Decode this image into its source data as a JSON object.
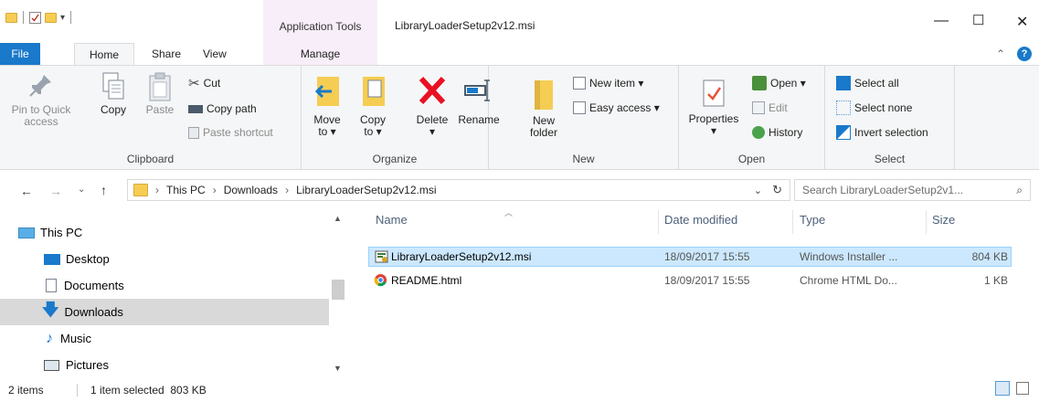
{
  "window": {
    "context_tab": "Application Tools",
    "title": "LibraryLoaderSetup2v12.msi",
    "minimize": "—",
    "maximize": "☐",
    "close": "✕"
  },
  "tabs": {
    "file": "File",
    "home": "Home",
    "share": "Share",
    "view": "View",
    "manage": "Manage"
  },
  "ribbon": {
    "clipboard": {
      "pin": "Pin to Quick\naccess",
      "copy": "Copy",
      "paste": "Paste",
      "cut": "Cut",
      "copy_path": "Copy path",
      "paste_shortcut": "Paste shortcut",
      "label": "Clipboard"
    },
    "organize": {
      "move_to": "Move\nto ▾",
      "copy_to": "Copy\nto ▾",
      "delete": "Delete\n▾",
      "rename": "Rename",
      "label": "Organize"
    },
    "new": {
      "new_folder": "New\nfolder",
      "new_item": "New item ▾",
      "easy_access": "Easy access ▾",
      "label": "New"
    },
    "open": {
      "properties": "Properties\n▾",
      "open": "Open ▾",
      "edit": "Edit",
      "history": "History",
      "label": "Open"
    },
    "select": {
      "select_all": "Select all",
      "select_none": "Select none",
      "invert": "Invert selection",
      "label": "Select"
    }
  },
  "address": {
    "crumbs": [
      "This PC",
      "Downloads",
      "LibraryLoaderSetup2v12.msi"
    ],
    "search_placeholder": "Search LibraryLoaderSetup2v1..."
  },
  "nav": {
    "items": [
      {
        "label": "This PC"
      },
      {
        "label": "Desktop"
      },
      {
        "label": "Documents"
      },
      {
        "label": "Downloads"
      },
      {
        "label": "Music"
      },
      {
        "label": "Pictures"
      }
    ]
  },
  "columns": {
    "name": "Name",
    "date": "Date modified",
    "type": "Type",
    "size": "Size"
  },
  "files": [
    {
      "name": "LibraryLoaderSetup2v12.msi",
      "date": "18/09/2017 15:55",
      "type": "Windows Installer ...",
      "size": "804 KB"
    },
    {
      "name": "README.html",
      "date": "18/09/2017 15:55",
      "type": "Chrome HTML Do...",
      "size": "1 KB"
    }
  ],
  "status": {
    "items": "2 items",
    "selected": "1 item selected  803 KB"
  },
  "colors": {
    "file_tab": "#1979ca",
    "selection": "#cce8ff",
    "folder": "#f5cd53"
  }
}
